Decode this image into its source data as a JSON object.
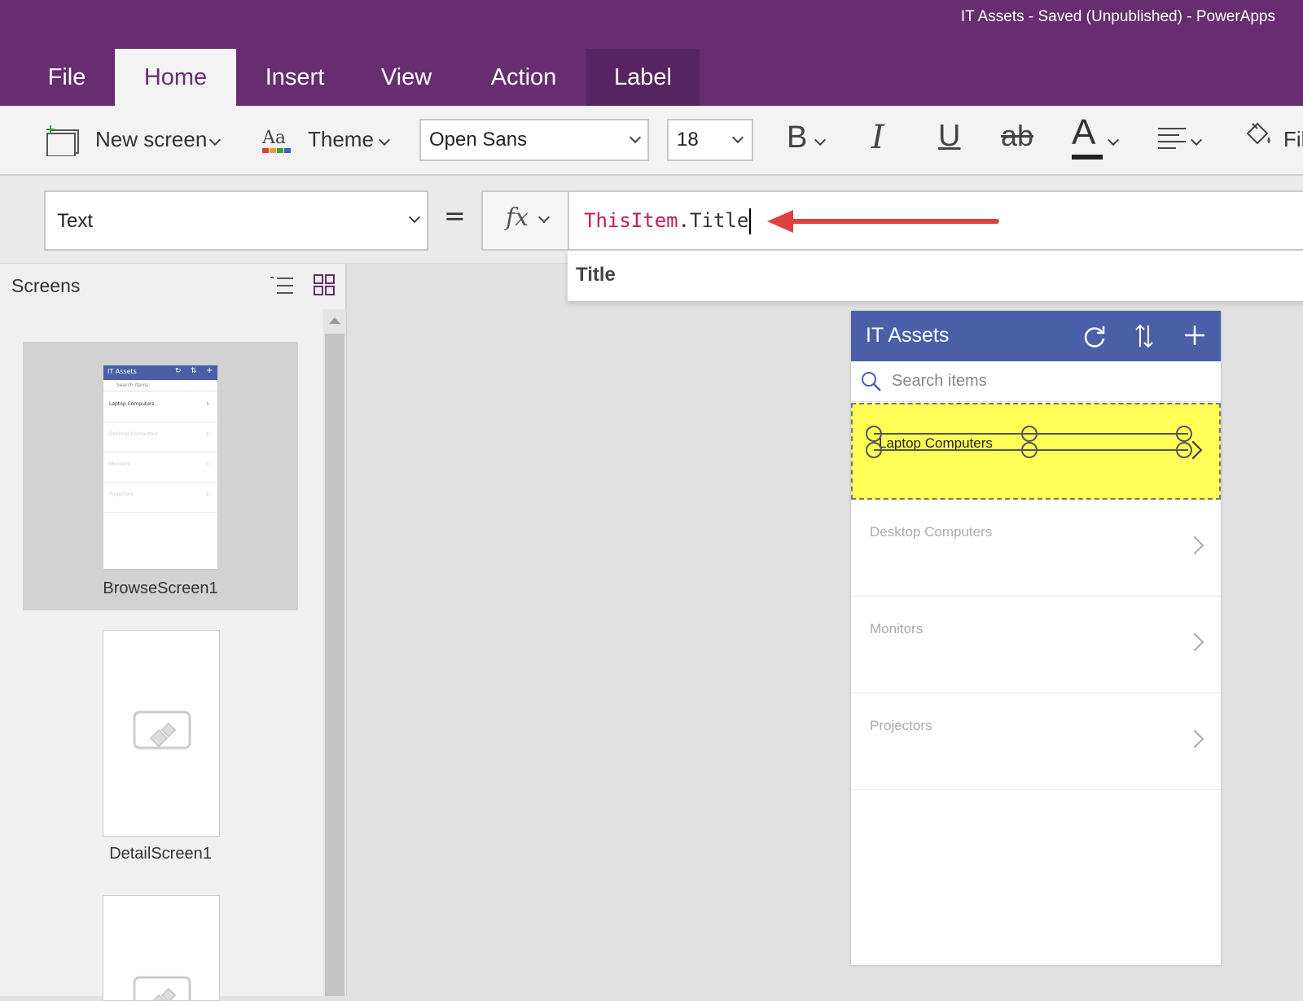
{
  "window": {
    "title": "IT Assets - Saved (Unpublished) - PowerApps"
  },
  "tabs": [
    {
      "label": "File"
    },
    {
      "label": "Home"
    },
    {
      "label": "Insert"
    },
    {
      "label": "View"
    },
    {
      "label": "Action"
    },
    {
      "label": "Label"
    }
  ],
  "ribbon": {
    "new_screen": "New screen",
    "theme": "Theme",
    "font_family": "Open Sans",
    "font_size": "18",
    "bold": "B",
    "italic": "I",
    "underline": "U",
    "strike": "ab",
    "font_color": "A",
    "fill_partial": "Fil"
  },
  "formula_bar": {
    "property": "Text",
    "equals": "=",
    "fx": "fx",
    "formula_keyword": "ThisItem",
    "formula_rest": ".Title",
    "suggestion": "Title"
  },
  "screens_panel": {
    "title": "Screens",
    "screens": [
      {
        "name": "BrowseScreen1"
      },
      {
        "name": "DetailScreen1"
      }
    ]
  },
  "thumbnail": {
    "app_title": "IT Assets",
    "search_placeholder": "Search items",
    "items": [
      "Laptop Computers",
      "Desktop Computers",
      "Monitors",
      "Projectors"
    ]
  },
  "app": {
    "title": "IT Assets",
    "search_placeholder": "Search items",
    "items": [
      {
        "title": "Laptop Computers"
      },
      {
        "title": "Desktop Computers"
      },
      {
        "title": "Monitors"
      },
      {
        "title": "Projectors"
      }
    ]
  },
  "colors": {
    "title_bar": "#672d70",
    "app_header": "#4a5fa8",
    "selection_highlight": "#ffff55",
    "annotation_arrow": "#e04040"
  }
}
